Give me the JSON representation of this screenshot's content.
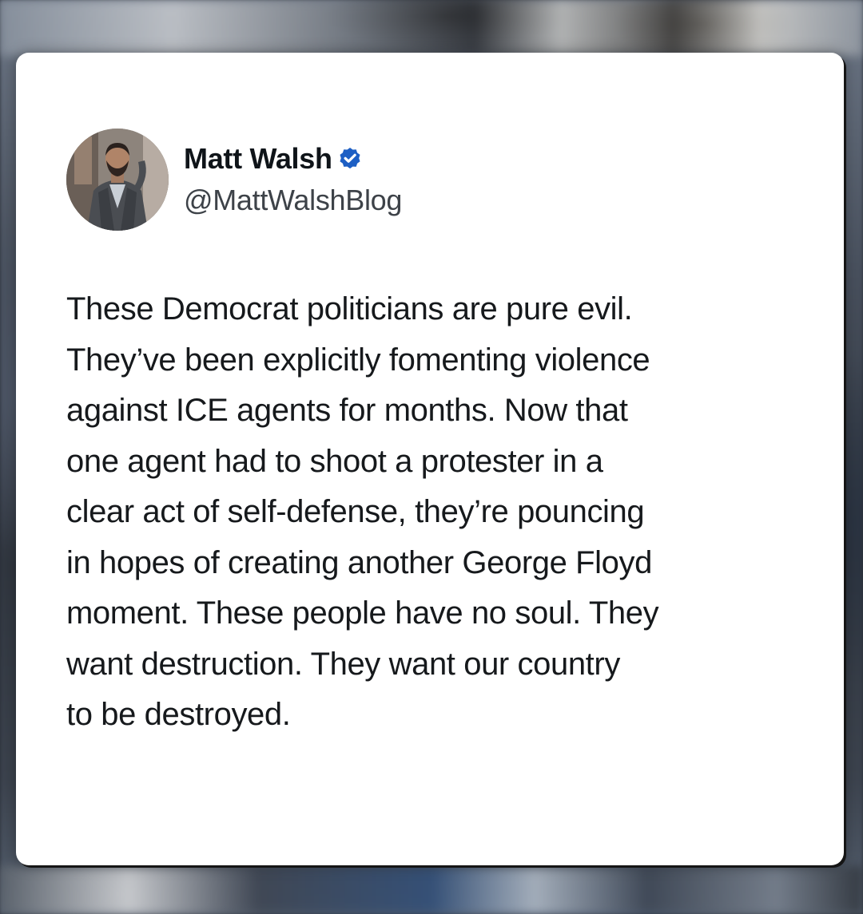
{
  "tweet": {
    "author": {
      "display_name": "Matt Walsh",
      "handle": "@MattWalshBlog",
      "verified_icon": "verified-badge-icon",
      "avatar": "profile-photo"
    },
    "text": "These Democrat politicians are pure evil.\nThey’ve been explicitly fomenting violence\nagainst ICE agents for months. Now that\none agent had to shoot a protester in a\nclear act of self-defense, they’re pouncing\nin hopes of creating another George Floyd\nmoment. These people have no soul. They\nwant destruction. They want our country\nto be destroyed."
  },
  "colors": {
    "card_background": "#ffffff",
    "text": "#0f1419",
    "handle_text": "#3d4248",
    "verified_badge": "#1d5fc4"
  }
}
